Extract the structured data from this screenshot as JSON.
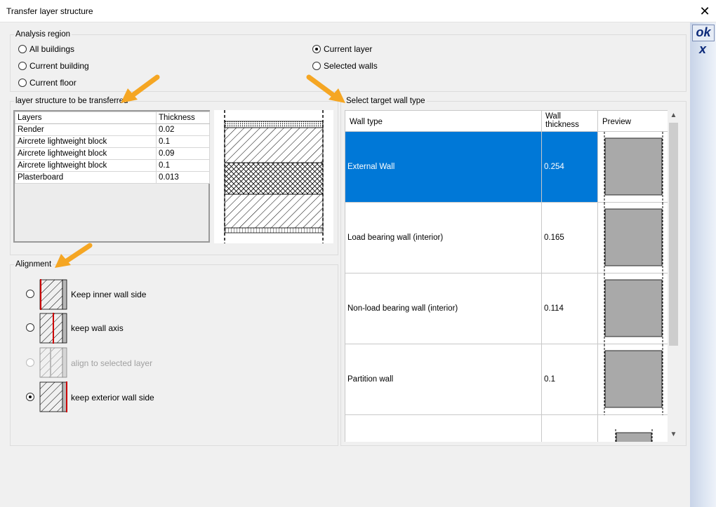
{
  "window": {
    "title": "Transfer layer structure"
  },
  "side_buttons": {
    "ok": "ok",
    "cancel": "x"
  },
  "analysis_region": {
    "legend": "Analysis region",
    "options": [
      {
        "label": "All buildings",
        "checked": false
      },
      {
        "label": "Current building",
        "checked": false
      },
      {
        "label": "Current floor",
        "checked": false
      },
      {
        "label": "Current layer",
        "checked": true
      },
      {
        "label": "Selected walls",
        "checked": false
      }
    ]
  },
  "layer_structure": {
    "legend": "layer structure to be transferred",
    "columns": [
      "Layers",
      "Thickness"
    ],
    "rows": [
      {
        "name": "Render",
        "thickness": "0.02"
      },
      {
        "name": "Aircrete lightweight block",
        "thickness": "0.1"
      },
      {
        "name": "Aircrete lightweight block",
        "thickness": "0.09"
      },
      {
        "name": "Aircrete lightweight block",
        "thickness": "0.1"
      },
      {
        "name": "Plasterboard",
        "thickness": "0.013"
      }
    ]
  },
  "alignment": {
    "legend": "Alignment",
    "options": [
      {
        "label": "Keep inner wall side",
        "checked": false,
        "enabled": true
      },
      {
        "label": "keep wall axis",
        "checked": false,
        "enabled": true
      },
      {
        "label": "align to selected layer",
        "checked": false,
        "enabled": false
      },
      {
        "label": "keep exterior wall side",
        "checked": true,
        "enabled": true
      }
    ]
  },
  "target_wall": {
    "legend": "Select target wall type",
    "columns": {
      "type": "Wall type",
      "thickness": "Wall\nthickness",
      "preview": "Preview"
    },
    "rows": [
      {
        "type": "External Wall",
        "thickness": "0.254",
        "selected": true
      },
      {
        "type": "Load bearing wall (interior)",
        "thickness": "0.165",
        "selected": false
      },
      {
        "type": "Non-load bearing wall (interior)",
        "thickness": "0.114",
        "selected": false
      },
      {
        "type": "Partition wall",
        "thickness": "0.1",
        "selected": false
      }
    ]
  },
  "colors": {
    "selection": "#0078d7",
    "arrow": "#f5a623",
    "accent_red": "#cc0000",
    "preview_fill": "#a9a9a9"
  }
}
